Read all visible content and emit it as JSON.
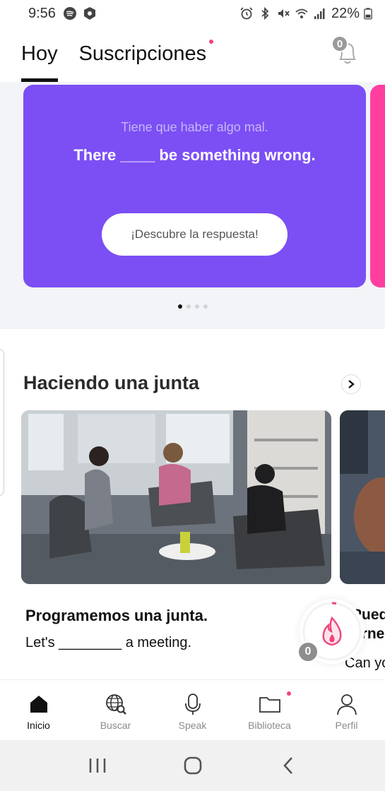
{
  "status_bar": {
    "time": "9:56",
    "battery": "22%",
    "left_icons": [
      "spotify-icon",
      "shield-app-icon"
    ],
    "right_icons": [
      "alarm-icon",
      "bluetooth-icon",
      "mute-icon",
      "wifi-icon",
      "signal-icon",
      "battery-icon"
    ]
  },
  "tabs": [
    {
      "label": "Hoy",
      "active": true
    },
    {
      "label": "Suscripciones",
      "active": false,
      "has_dot": true
    }
  ],
  "notifications": {
    "count": "0"
  },
  "hero": {
    "translation": "Tiene que haber algo mal.",
    "sentence": "There ____ be something wrong.",
    "button_label": "¡Descubre la respuesta!",
    "pages": 4,
    "active_page": 1,
    "color": "#7b4ff4",
    "peek_color": "#ff3fa0"
  },
  "section": {
    "title": "Haciendo una junta"
  },
  "cards": [
    {
      "title": "Programemos una junta.",
      "sentence": "Let's ________ a meeting."
    },
    {
      "title_line1": "Pued",
      "title_line2": "erne",
      "sentence": "Can yo"
    }
  ],
  "streak": {
    "count": "0",
    "accent": "#f0457a"
  },
  "bottom_nav": [
    {
      "label": "Inicio",
      "icon": "home-icon",
      "active": true
    },
    {
      "label": "Buscar",
      "icon": "globe-search-icon",
      "active": false
    },
    {
      "label": "Speak",
      "icon": "microphone-icon",
      "active": false
    },
    {
      "label": "Biblioteca",
      "icon": "folder-icon",
      "active": false,
      "has_dot": true
    },
    {
      "label": "Perfil",
      "icon": "person-icon",
      "active": false
    }
  ]
}
